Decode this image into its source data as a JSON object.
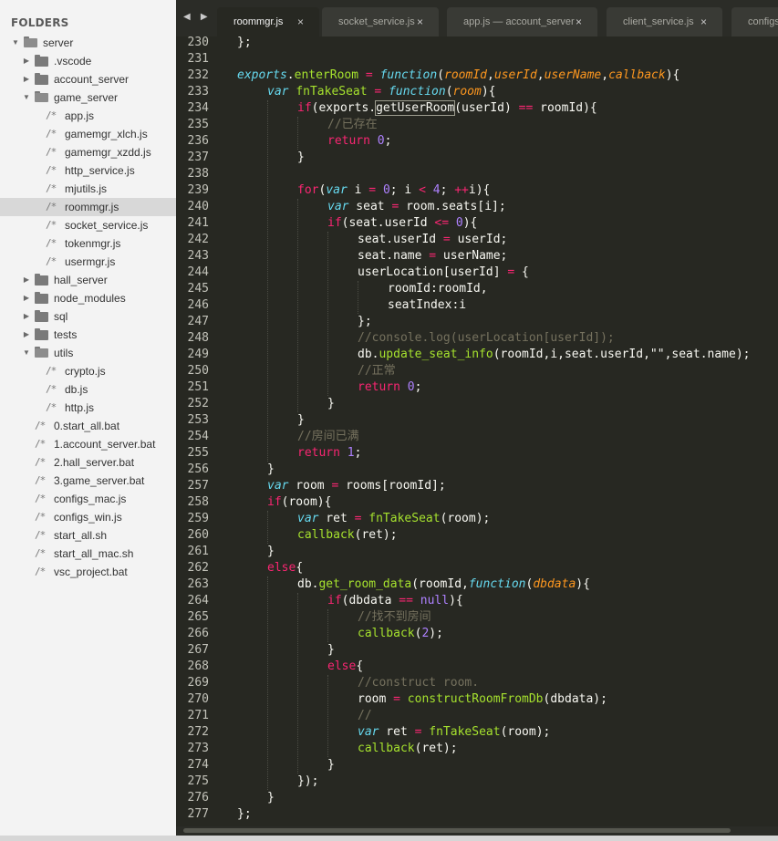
{
  "sidebar": {
    "header": "FOLDERS",
    "items": [
      {
        "label": "server",
        "type": "folder",
        "depth": 0,
        "expanded": true
      },
      {
        "label": ".vscode",
        "type": "folder",
        "depth": 1,
        "expanded": false
      },
      {
        "label": "account_server",
        "type": "folder",
        "depth": 1,
        "expanded": false
      },
      {
        "label": "game_server",
        "type": "folder",
        "depth": 1,
        "expanded": true
      },
      {
        "label": "app.js",
        "type": "file",
        "depth": 2
      },
      {
        "label": "gamemgr_xlch.js",
        "type": "file",
        "depth": 2
      },
      {
        "label": "gamemgr_xzdd.js",
        "type": "file",
        "depth": 2
      },
      {
        "label": "http_service.js",
        "type": "file",
        "depth": 2
      },
      {
        "label": "mjutils.js",
        "type": "file",
        "depth": 2
      },
      {
        "label": "roommgr.js",
        "type": "file",
        "depth": 2,
        "selected": true
      },
      {
        "label": "socket_service.js",
        "type": "file",
        "depth": 2
      },
      {
        "label": "tokenmgr.js",
        "type": "file",
        "depth": 2
      },
      {
        "label": "usermgr.js",
        "type": "file",
        "depth": 2
      },
      {
        "label": "hall_server",
        "type": "folder",
        "depth": 1,
        "expanded": false
      },
      {
        "label": "node_modules",
        "type": "folder",
        "depth": 1,
        "expanded": false
      },
      {
        "label": "sql",
        "type": "folder",
        "depth": 1,
        "expanded": false
      },
      {
        "label": "tests",
        "type": "folder",
        "depth": 1,
        "expanded": false
      },
      {
        "label": "utils",
        "type": "folder",
        "depth": 1,
        "expanded": true
      },
      {
        "label": "crypto.js",
        "type": "file",
        "depth": 2
      },
      {
        "label": "db.js",
        "type": "file",
        "depth": 2
      },
      {
        "label": "http.js",
        "type": "file",
        "depth": 2
      },
      {
        "label": "0.start_all.bat",
        "type": "file",
        "depth": 1
      },
      {
        "label": "1.account_server.bat",
        "type": "file",
        "depth": 1
      },
      {
        "label": "2.hall_server.bat",
        "type": "file",
        "depth": 1
      },
      {
        "label": "3.game_server.bat",
        "type": "file",
        "depth": 1
      },
      {
        "label": "configs_mac.js",
        "type": "file",
        "depth": 1
      },
      {
        "label": "configs_win.js",
        "type": "file",
        "depth": 1
      },
      {
        "label": "start_all.sh",
        "type": "file",
        "depth": 1
      },
      {
        "label": "start_all_mac.sh",
        "type": "file",
        "depth": 1
      },
      {
        "label": "vsc_project.bat",
        "type": "file",
        "depth": 1
      }
    ]
  },
  "tabs": [
    {
      "label": "roommgr.js",
      "active": true,
      "close": "×"
    },
    {
      "label": "socket_service.js",
      "active": false,
      "close": "×"
    },
    {
      "label": "app.js — account_server",
      "active": false,
      "close": "×"
    },
    {
      "label": "client_service.js",
      "active": false,
      "close": "×"
    },
    {
      "label": "configs",
      "active": false,
      "close": ""
    }
  ],
  "nav_arrows": "◀ ▶",
  "editor": {
    "lines": [
      {
        "n": 230,
        "i": 0,
        "t": [
          [
            "",
            "};"
          ]
        ]
      },
      {
        "n": 231,
        "i": 0,
        "t": []
      },
      {
        "n": 232,
        "i": 0,
        "t": [
          [
            "st",
            "exports"
          ],
          [
            "",
            "."
          ],
          [
            "fn",
            "enterRoom"
          ],
          [
            "",
            " "
          ],
          [
            "op",
            "="
          ],
          [
            "",
            " "
          ],
          [
            "st",
            "function"
          ],
          [
            "",
            "("
          ],
          [
            "pa",
            "roomId"
          ],
          [
            "",
            ","
          ],
          [
            "pa",
            "userId"
          ],
          [
            "",
            ","
          ],
          [
            "pa",
            "userName"
          ],
          [
            "",
            ","
          ],
          [
            "pa",
            "callback"
          ],
          [
            "",
            "){"
          ]
        ]
      },
      {
        "n": 233,
        "i": 1,
        "t": [
          [
            "st",
            "var"
          ],
          [
            "",
            " "
          ],
          [
            "fn",
            "fnTakeSeat"
          ],
          [
            "",
            " "
          ],
          [
            "op",
            "="
          ],
          [
            "",
            " "
          ],
          [
            "st",
            "function"
          ],
          [
            "",
            "("
          ],
          [
            "pa",
            "room"
          ],
          [
            "",
            "){"
          ]
        ]
      },
      {
        "n": 234,
        "i": 2,
        "t": [
          [
            "kw",
            "if"
          ],
          [
            "",
            "(exports."
          ],
          [
            "hl",
            "getUserRoom"
          ],
          [
            "",
            "(userId) "
          ],
          [
            "op",
            "=="
          ],
          [
            "",
            " roomId){"
          ]
        ]
      },
      {
        "n": 235,
        "i": 3,
        "t": [
          [
            "cm",
            "//已存在"
          ]
        ]
      },
      {
        "n": 236,
        "i": 3,
        "t": [
          [
            "kw",
            "return"
          ],
          [
            "",
            " "
          ],
          [
            "nu",
            "0"
          ],
          [
            "",
            ";"
          ]
        ]
      },
      {
        "n": 237,
        "i": 2,
        "t": [
          [
            "",
            "}"
          ]
        ]
      },
      {
        "n": 238,
        "i": 0,
        "t": []
      },
      {
        "n": 239,
        "i": 2,
        "t": [
          [
            "kw",
            "for"
          ],
          [
            "",
            "("
          ],
          [
            "st",
            "var"
          ],
          [
            "",
            " i "
          ],
          [
            "op",
            "="
          ],
          [
            "",
            " "
          ],
          [
            "nu",
            "0"
          ],
          [
            "",
            "; i "
          ],
          [
            "op",
            "<"
          ],
          [
            "",
            " "
          ],
          [
            "nu",
            "4"
          ],
          [
            "",
            "; "
          ],
          [
            "op",
            "++"
          ],
          [
            "",
            "i){"
          ]
        ]
      },
      {
        "n": 240,
        "i": 3,
        "t": [
          [
            "st",
            "var"
          ],
          [
            "",
            " seat "
          ],
          [
            "op",
            "="
          ],
          [
            "",
            " room.seats[i];"
          ]
        ]
      },
      {
        "n": 241,
        "i": 3,
        "t": [
          [
            "kw",
            "if"
          ],
          [
            "",
            "(seat.userId "
          ],
          [
            "op",
            "<="
          ],
          [
            "",
            " "
          ],
          [
            "nu",
            "0"
          ],
          [
            "",
            "){"
          ]
        ]
      },
      {
        "n": 242,
        "i": 4,
        "t": [
          [
            "",
            "seat.userId "
          ],
          [
            "op",
            "="
          ],
          [
            "",
            " userId;"
          ]
        ]
      },
      {
        "n": 243,
        "i": 4,
        "t": [
          [
            "",
            "seat.name "
          ],
          [
            "op",
            "="
          ],
          [
            "",
            " userName;"
          ]
        ]
      },
      {
        "n": 244,
        "i": 4,
        "t": [
          [
            "",
            "userLocation[userId] "
          ],
          [
            "op",
            "="
          ],
          [
            "",
            " {"
          ]
        ]
      },
      {
        "n": 245,
        "i": 5,
        "t": [
          [
            "",
            "roomId:roomId,"
          ]
        ]
      },
      {
        "n": 246,
        "i": 5,
        "t": [
          [
            "",
            "seatIndex:i"
          ]
        ]
      },
      {
        "n": 247,
        "i": 4,
        "t": [
          [
            "",
            "};"
          ]
        ]
      },
      {
        "n": 248,
        "i": 4,
        "t": [
          [
            "cm",
            "//console.log(userLocation[userId]);"
          ]
        ]
      },
      {
        "n": 249,
        "i": 4,
        "t": [
          [
            "",
            "db."
          ],
          [
            "fn",
            "update_seat_info"
          ],
          [
            "",
            "(roomId,i,seat.userId,"
          ],
          [
            "",
            "\"\""
          ],
          [
            "",
            ",seat.name);"
          ]
        ]
      },
      {
        "n": 250,
        "i": 4,
        "t": [
          [
            "cm",
            "//正常"
          ]
        ]
      },
      {
        "n": 251,
        "i": 4,
        "t": [
          [
            "kw",
            "return"
          ],
          [
            "",
            " "
          ],
          [
            "nu",
            "0"
          ],
          [
            "",
            ";"
          ]
        ]
      },
      {
        "n": 252,
        "i": 3,
        "t": [
          [
            "",
            "}"
          ]
        ]
      },
      {
        "n": 253,
        "i": 2,
        "t": [
          [
            "",
            "}"
          ]
        ]
      },
      {
        "n": 254,
        "i": 2,
        "t": [
          [
            "cm",
            "//房间已满"
          ]
        ]
      },
      {
        "n": 255,
        "i": 2,
        "t": [
          [
            "kw",
            "return"
          ],
          [
            "",
            " "
          ],
          [
            "nu",
            "1"
          ],
          [
            "",
            ";"
          ]
        ]
      },
      {
        "n": 256,
        "i": 1,
        "t": [
          [
            "",
            "}"
          ]
        ]
      },
      {
        "n": 257,
        "i": 1,
        "t": [
          [
            "st",
            "var"
          ],
          [
            "",
            " room "
          ],
          [
            "op",
            "="
          ],
          [
            "",
            " rooms[roomId];"
          ]
        ]
      },
      {
        "n": 258,
        "i": 1,
        "t": [
          [
            "kw",
            "if"
          ],
          [
            "",
            "(room){"
          ]
        ]
      },
      {
        "n": 259,
        "i": 2,
        "t": [
          [
            "st",
            "var"
          ],
          [
            "",
            " ret "
          ],
          [
            "op",
            "="
          ],
          [
            "",
            " "
          ],
          [
            "fn",
            "fnTakeSeat"
          ],
          [
            "",
            "(room);"
          ]
        ]
      },
      {
        "n": 260,
        "i": 2,
        "t": [
          [
            "fn",
            "callback"
          ],
          [
            "",
            "(ret);"
          ]
        ]
      },
      {
        "n": 261,
        "i": 1,
        "t": [
          [
            "",
            "}"
          ]
        ]
      },
      {
        "n": 262,
        "i": 1,
        "t": [
          [
            "kw",
            "else"
          ],
          [
            "",
            "{"
          ]
        ]
      },
      {
        "n": 263,
        "i": 2,
        "t": [
          [
            "",
            "db."
          ],
          [
            "fn",
            "get_room_data"
          ],
          [
            "",
            "(roomId,"
          ],
          [
            "st",
            "function"
          ],
          [
            "",
            "("
          ],
          [
            "pa",
            "dbdata"
          ],
          [
            "",
            "){"
          ]
        ]
      },
      {
        "n": 264,
        "i": 3,
        "t": [
          [
            "kw",
            "if"
          ],
          [
            "",
            "(dbdata "
          ],
          [
            "op",
            "=="
          ],
          [
            "",
            " "
          ],
          [
            "nu",
            "null"
          ],
          [
            "",
            "){"
          ]
        ]
      },
      {
        "n": 265,
        "i": 4,
        "t": [
          [
            "cm",
            "//找不到房间"
          ]
        ]
      },
      {
        "n": 266,
        "i": 4,
        "t": [
          [
            "fn",
            "callback"
          ],
          [
            "",
            "("
          ],
          [
            "nu",
            "2"
          ],
          [
            "",
            ");"
          ]
        ]
      },
      {
        "n": 267,
        "i": 3,
        "t": [
          [
            "",
            "}"
          ]
        ]
      },
      {
        "n": 268,
        "i": 3,
        "t": [
          [
            "kw",
            "else"
          ],
          [
            "",
            "{"
          ]
        ]
      },
      {
        "n": 269,
        "i": 4,
        "t": [
          [
            "cm",
            "//construct room."
          ]
        ]
      },
      {
        "n": 270,
        "i": 4,
        "t": [
          [
            "",
            "room "
          ],
          [
            "op",
            "="
          ],
          [
            "",
            " "
          ],
          [
            "fn",
            "constructRoomFromDb"
          ],
          [
            "",
            "(dbdata);"
          ]
        ]
      },
      {
        "n": 271,
        "i": 4,
        "t": [
          [
            "cm",
            "//"
          ]
        ]
      },
      {
        "n": 272,
        "i": 4,
        "t": [
          [
            "st",
            "var"
          ],
          [
            "",
            " ret "
          ],
          [
            "op",
            "="
          ],
          [
            "",
            " "
          ],
          [
            "fn",
            "fnTakeSeat"
          ],
          [
            "",
            "(room);"
          ]
        ]
      },
      {
        "n": 273,
        "i": 4,
        "t": [
          [
            "fn",
            "callback"
          ],
          [
            "",
            "(ret);"
          ]
        ]
      },
      {
        "n": 274,
        "i": 3,
        "t": [
          [
            "",
            "}"
          ]
        ]
      },
      {
        "n": 275,
        "i": 2,
        "t": [
          [
            "",
            "});"
          ]
        ]
      },
      {
        "n": 276,
        "i": 1,
        "t": [
          [
            "",
            "}"
          ]
        ]
      },
      {
        "n": 277,
        "i": 0,
        "t": [
          [
            "",
            "};"
          ]
        ]
      }
    ]
  },
  "colors": {
    "editor_bg": "#272822",
    "keyword": "#f92672",
    "storage": "#66d9ef",
    "function": "#a6e22e",
    "parameter": "#fd971f",
    "number": "#ae81ff",
    "comment": "#75715e",
    "sidebar_bg": "#f3f3f3",
    "selected_row": "#d8d8d8"
  }
}
